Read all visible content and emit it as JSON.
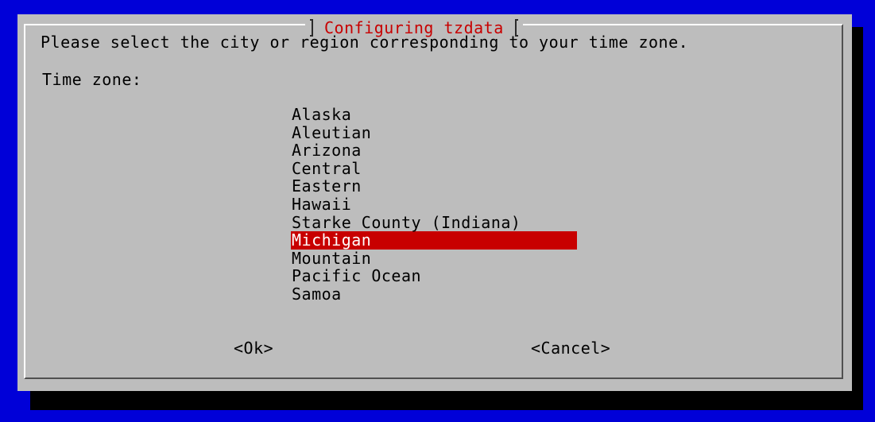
{
  "dialog": {
    "title": "Configuring tzdata",
    "prompt": "Please select the city or region corresponding to your time zone.",
    "field_label": "Time zone:"
  },
  "timezone_list": {
    "items": [
      "Alaska",
      "Aleutian",
      "Arizona",
      "Central",
      "Eastern",
      "Hawaii",
      "Starke County (Indiana)",
      "Michigan",
      "Mountain",
      "Pacific Ocean",
      "Samoa"
    ],
    "selected": "Michigan"
  },
  "buttons": {
    "ok_label": "<Ok>",
    "cancel_label": "<Cancel>"
  },
  "colors": {
    "background": "#0000d8",
    "dialog": "#bdbdbd",
    "title": "#c80000",
    "selection": "#c80000"
  }
}
